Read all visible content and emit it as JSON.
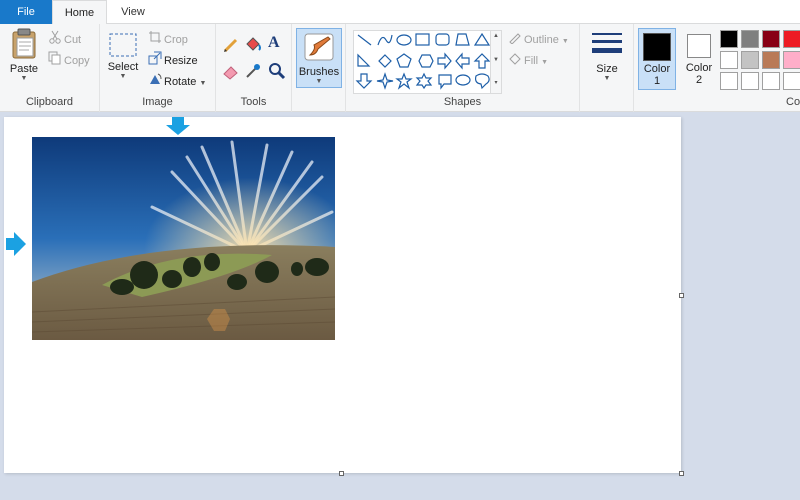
{
  "tabs": {
    "file": "File",
    "home": "Home",
    "view": "View"
  },
  "clipboard": {
    "paste": "Paste",
    "cut": "Cut",
    "copy": "Copy",
    "label": "Clipboard"
  },
  "image": {
    "select": "Select",
    "crop": "Crop",
    "resize": "Resize",
    "rotate": "Rotate",
    "label": "Image"
  },
  "tools": {
    "label": "Tools",
    "items": [
      "pencil-icon",
      "fill-bucket-icon",
      "text-icon",
      "eraser-icon",
      "color-picker-icon",
      "magnifier-icon"
    ]
  },
  "brushes": {
    "label": "Brushes"
  },
  "shapes": {
    "label": "Shapes",
    "outline": "Outline",
    "fill": "Fill"
  },
  "size": {
    "label": "Size"
  },
  "colors": {
    "color1_label": "Color",
    "color1_num": "1",
    "color2_label": "Color",
    "color2_num": "2",
    "group_label_partial": "Co",
    "color1": "#000000",
    "color2": "#ffffff",
    "palette_row1": [
      "#000000",
      "#7f7f7f",
      "#880015",
      "#ed1c24"
    ],
    "palette_row2": [
      "#ffffff",
      "#c3c3c3",
      "#b97a57",
      "#ffaec9"
    ],
    "palette_row3": [
      "#ffffff",
      "#ffffff",
      "#ffffff",
      "#ffffff"
    ]
  },
  "theme": {
    "accent": "#1979ca",
    "selected_bg": "#c9e0f7"
  }
}
